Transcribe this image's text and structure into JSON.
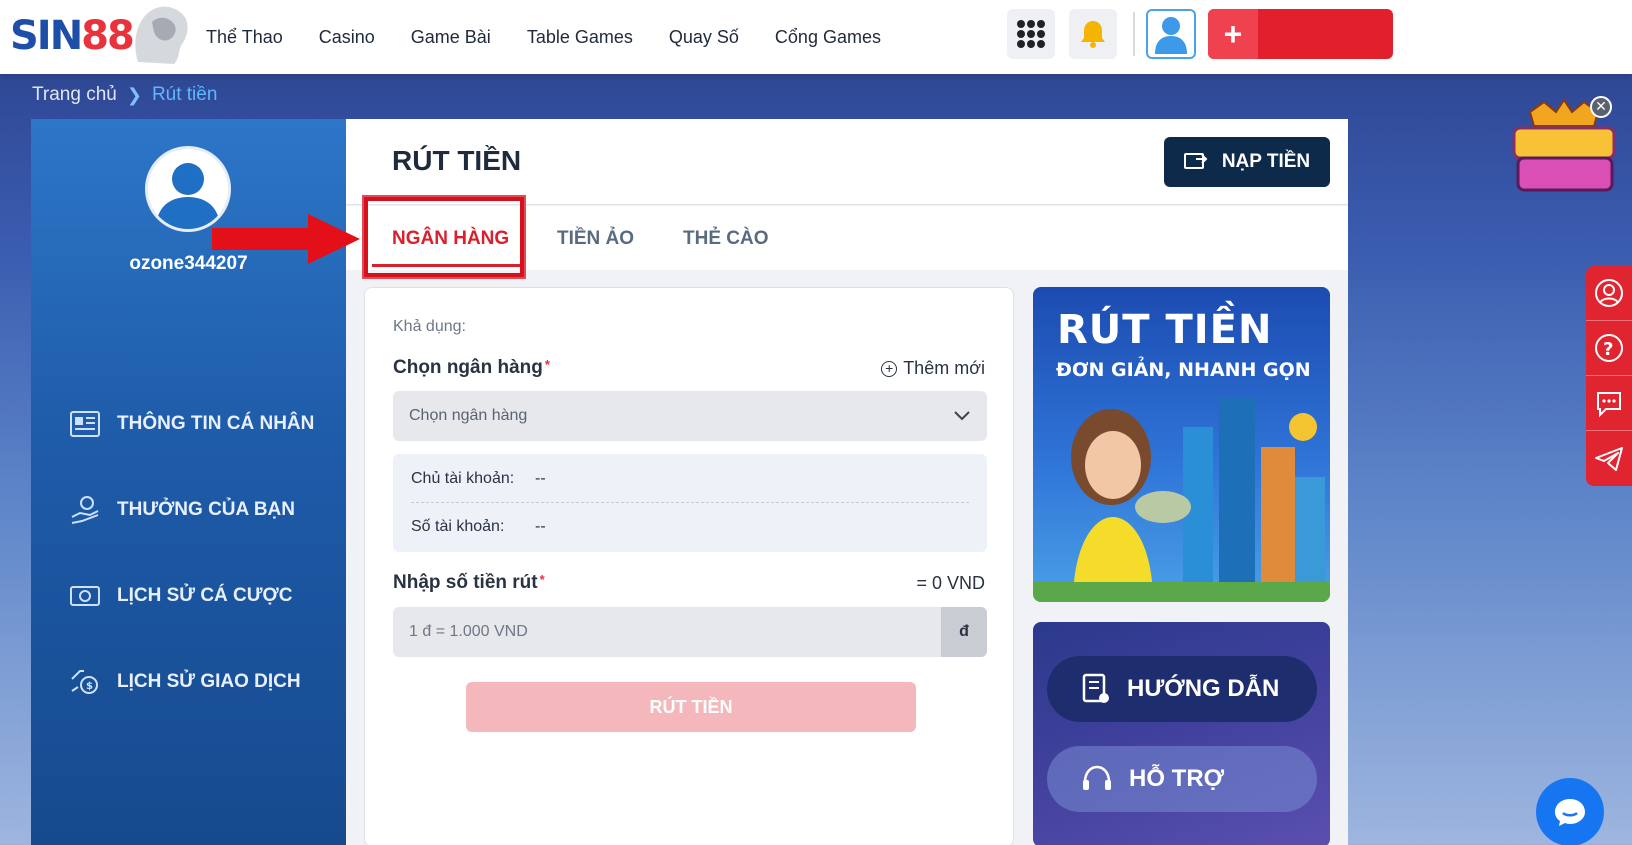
{
  "header": {
    "logo": {
      "part1": "SIN",
      "part2": "88"
    },
    "nav": [
      "Thể Thao",
      "Casino",
      "Game Bài",
      "Table Games",
      "Quay Số",
      "Cổng Games"
    ]
  },
  "breadcrumb": {
    "home": "Trang chủ",
    "current": "Rút tiền"
  },
  "sidebar": {
    "username": "ozone344207",
    "menu": [
      {
        "label": "THÔNG TIN CÁ NHÂN",
        "icon": "id-card-icon"
      },
      {
        "label": "THƯỞNG CỦA BẠN",
        "icon": "reward-hand-icon"
      },
      {
        "label": "LỊCH SỬ CÁ CƯỢC",
        "icon": "cash-icon"
      },
      {
        "label": "LỊCH SỬ GIAO DỊCH",
        "icon": "transaction-icon"
      }
    ]
  },
  "main": {
    "title": "RÚT TIỀN",
    "deposit_label": "NẠP TIỀN",
    "tabs": [
      "NGÂN HÀNG",
      "TIỀN ẢO",
      "THẺ CÀO"
    ],
    "active_tab": 0
  },
  "form": {
    "available_label": "Khả dụng:",
    "bank_label": "Chọn ngân hàng",
    "add_new": "Thêm mới",
    "bank_select_placeholder": "Chọn ngân hàng",
    "account_holder_label": "Chủ tài khoản:",
    "account_holder_value": "--",
    "account_number_label": "Số tài khoản:",
    "account_number_value": "--",
    "amount_label": "Nhập số tiền rút",
    "amount_equivalent": "= 0 VND",
    "amount_placeholder": "1 đ = 1.000 VND",
    "unit": "đ",
    "submit_label": "RÚT TIỀN"
  },
  "banners": {
    "withdraw_title": "RÚT TIỀN",
    "withdraw_sub": "ĐƠN GIẢN, NHANH GỌN",
    "guide": "HƯỚNG DẪN",
    "support": "HỖ TRỢ"
  },
  "colors": {
    "accent_red": "#e21f2c",
    "navy": "#0d2a4a",
    "sidebar_blue": "#1e5ba8"
  }
}
